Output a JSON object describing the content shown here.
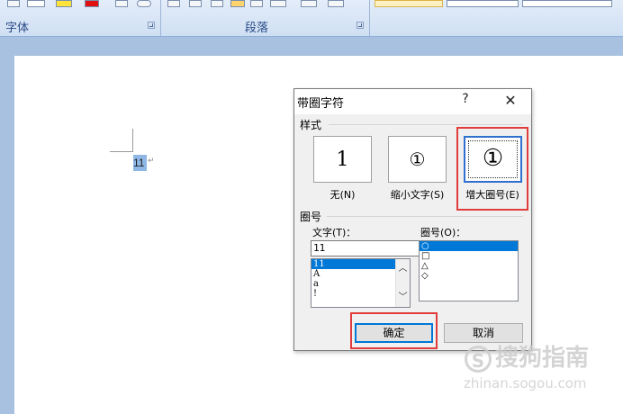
{
  "ribbon": {
    "group_font": "字体",
    "group_paragraph": "段落"
  },
  "document": {
    "selected_text": "11",
    "paragraph_mark": "↵"
  },
  "dialog": {
    "title": "带圈字符",
    "help_label": "?",
    "close_label": "✕",
    "style_section": "样式",
    "styles": [
      {
        "glyph": "1",
        "caption": "无(N)"
      },
      {
        "glyph": "①",
        "caption": "缩小文字(S)"
      },
      {
        "glyph": "①",
        "caption": "增大圈号(E)"
      }
    ],
    "selected_style_index": 2,
    "enclosure_section": "圈号",
    "text_label": "文字(T)：",
    "text_value": "11",
    "text_list": [
      "11",
      "A",
      "a",
      "!"
    ],
    "symbol_label": "圈号(O)：",
    "symbol_list": [
      "○",
      "□",
      "△",
      "◇"
    ],
    "ok_label": "确定",
    "cancel_label": "取消"
  },
  "watermark": {
    "logo_char": "S",
    "brand": "搜狗指南",
    "url": "zhinan.sogou.com"
  },
  "colors": {
    "highlight_red": "#e03c3c",
    "selection_blue": "#0078d7",
    "text_highlight": "#8fb7e6"
  }
}
